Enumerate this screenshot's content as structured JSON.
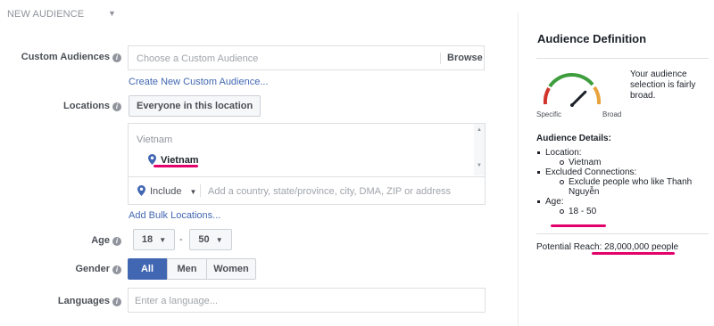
{
  "header": {
    "title": "NEW AUDIENCE",
    "caret": "▼"
  },
  "custom_audiences": {
    "label": "Custom Audiences",
    "placeholder": "Choose a Custom Audience",
    "browse_label": "Browse",
    "create_link": "Create New Custom Audience..."
  },
  "locations": {
    "label": "Locations",
    "dropdown_value": "Everyone in this location",
    "group_title": "Vietnam",
    "selected_item": "Vietnam",
    "include_label": "Include",
    "search_placeholder": "Add a country, state/province, city, DMA, ZIP or address",
    "bulk_link": "Add Bulk Locations..."
  },
  "age": {
    "label": "Age",
    "min": "18",
    "separator": "-",
    "max": "50"
  },
  "gender": {
    "label": "Gender",
    "options": [
      "All",
      "Men",
      "Women"
    ],
    "selected": "All"
  },
  "languages": {
    "label": "Languages",
    "placeholder": "Enter a language..."
  },
  "audience_definition": {
    "title": "Audience Definition",
    "gauge_specific": "Specific",
    "gauge_broad": "Broad",
    "gauge_level": 0.75,
    "description": "Your audience selection is fairly broad.",
    "details_title": "Audience Details:",
    "location_label": "Location:",
    "location_value": "Vietnam",
    "excluded_label": "Excluded Connections:",
    "excluded_value": "Exclude people who like Thanh Nguyễn",
    "age_label": "Age:",
    "age_value": "18 - 50",
    "potential_reach": "Potential Reach: 28,000,000 people"
  },
  "colors": {
    "accent": "#4267b2",
    "highlight": "#e4006b",
    "gauge_red": "#d0342c",
    "gauge_green": "#3e9e3e",
    "gauge_orange": "#e8a33d"
  }
}
